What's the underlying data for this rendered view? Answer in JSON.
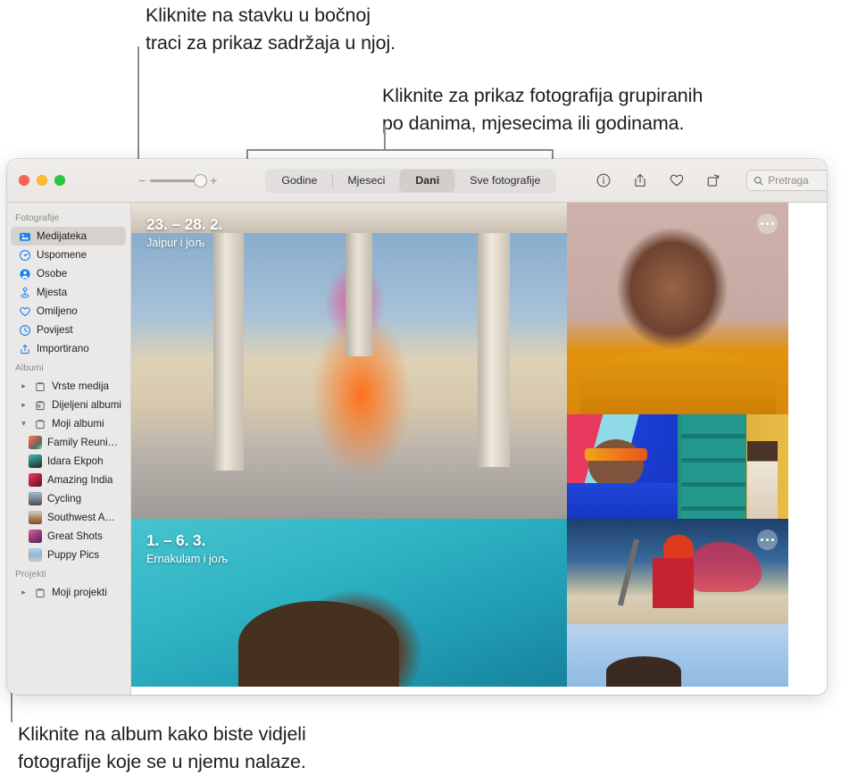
{
  "callouts": {
    "sidebar": "Kliknite na stavku u bočnoj\ntraci za prikaz sadržaja u njoj.",
    "viewmode": "Kliknite za prikaz fotografija grupiranih\npo danima, mjesecima ili godinama.",
    "album": "Kliknite na album kako biste vidjeli\nfotografije koje se u njemu nalaze."
  },
  "window": {
    "traffic_lights": [
      "close-button",
      "minimize-button",
      "zoom-button"
    ]
  },
  "toolbar": {
    "zoom_slider": {
      "minus_label": "−",
      "plus_label": "+",
      "value": 92
    },
    "segments": [
      {
        "label": "Godine",
        "selected": false
      },
      {
        "label": "Mjeseci",
        "selected": false
      },
      {
        "label": "Dani",
        "selected": true
      },
      {
        "label": "Sve fotografije",
        "selected": false
      }
    ],
    "actions": [
      {
        "name": "info-icon"
      },
      {
        "name": "share-icon"
      },
      {
        "name": "favorite-heart-icon"
      },
      {
        "name": "rotate-icon"
      }
    ],
    "search": {
      "icon": "search-icon",
      "placeholder": "Pretraga",
      "value": ""
    }
  },
  "sidebar": {
    "sections": [
      {
        "title": "Fotografije",
        "items": [
          {
            "label": "Medijateka",
            "icon": "photo-library-icon",
            "selected": true,
            "kind": "icon"
          },
          {
            "label": "Uspomene",
            "icon": "memories-icon",
            "selected": false,
            "kind": "icon"
          },
          {
            "label": "Osobe",
            "icon": "people-icon",
            "selected": false,
            "kind": "icon"
          },
          {
            "label": "Mjesta",
            "icon": "places-pin-icon",
            "selected": false,
            "kind": "icon"
          },
          {
            "label": "Omiljeno",
            "icon": "heart-icon",
            "selected": false,
            "kind": "icon"
          },
          {
            "label": "Povijest",
            "icon": "recents-clock-icon",
            "selected": false,
            "kind": "icon"
          },
          {
            "label": "Importirano",
            "icon": "imported-icon",
            "selected": false,
            "kind": "icon"
          }
        ]
      },
      {
        "title": "Albumi",
        "items": [
          {
            "label": "Vrste medija",
            "icon": "folder-icon",
            "kind": "disclosure",
            "expanded": false
          },
          {
            "label": "Dijeljeni albumi",
            "icon": "shared-folder-icon",
            "kind": "disclosure",
            "expanded": false
          },
          {
            "label": "Moji albumi",
            "icon": "folder-icon",
            "kind": "disclosure",
            "expanded": true
          },
          {
            "label": "Family Reuni…",
            "kind": "album",
            "thumb": "thumb-family-reunion"
          },
          {
            "label": "Idara Ekpoh",
            "kind": "album",
            "thumb": "thumb-idara-ekpoh"
          },
          {
            "label": "Amazing India",
            "kind": "album",
            "thumb": "thumb-amazing-india"
          },
          {
            "label": "Cycling",
            "kind": "album",
            "thumb": "thumb-cycling"
          },
          {
            "label": "Southwest A…",
            "kind": "album",
            "thumb": "thumb-southwest"
          },
          {
            "label": "Great Shots",
            "kind": "album",
            "thumb": "thumb-great-shots"
          },
          {
            "label": "Puppy Pics",
            "kind": "album",
            "thumb": "thumb-puppy-pics"
          }
        ]
      },
      {
        "title": "Projekti",
        "items": [
          {
            "label": "Moji projekti",
            "icon": "folder-icon",
            "kind": "disclosure",
            "expanded": false
          }
        ]
      }
    ]
  },
  "photo_grid": {
    "groups": [
      {
        "date": "23. – 28. 2.",
        "place": "Jaipur i joљ",
        "photos": [
          {
            "name": "photo-dancer-pavilion"
          },
          {
            "name": "photo-woman-orange-scarf",
            "more_badge": true
          },
          {
            "name": "photo-man-sunglasses"
          },
          {
            "name": "photo-woman-green-door"
          }
        ]
      },
      {
        "date": "1. – 6. 3.",
        "place": "Ernakulam i joљ",
        "photos": [
          {
            "name": "photo-swimmer"
          },
          {
            "name": "photo-cyclist-red-cape",
            "more_badge": true
          },
          {
            "name": "photo-sky-portrait"
          }
        ]
      }
    ]
  },
  "colors": {
    "accent": "#1a82f0",
    "selected_row": "#d5d1cd",
    "sidebar_bg": "#ebe9e7",
    "toolbar_bg": "#eae7e4"
  }
}
